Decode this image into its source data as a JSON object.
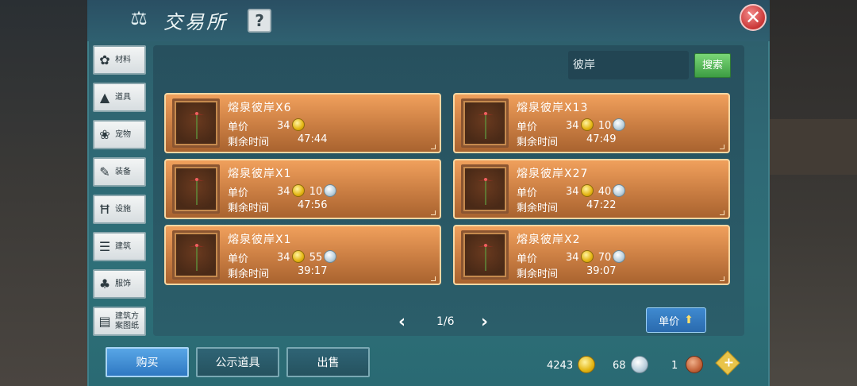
{
  "title": {
    "text": "交易所",
    "help": "?",
    "close": "✕"
  },
  "sidebar": {
    "items": [
      {
        "label": "材料",
        "icon": "materials-icon"
      },
      {
        "label": "道具",
        "icon": "props-icon"
      },
      {
        "label": "宠物",
        "icon": "pet-icon"
      },
      {
        "label": "装备",
        "icon": "equipment-icon"
      },
      {
        "label": "设施",
        "icon": "facility-icon"
      },
      {
        "label": "建筑",
        "icon": "building-icon"
      },
      {
        "label": "服饰",
        "icon": "clothing-icon"
      },
      {
        "label": "建筑方\n案图纸",
        "icon": "blueprint-icon"
      }
    ]
  },
  "search": {
    "value": "彼岸",
    "button": "搜索"
  },
  "labels": {
    "price": "单价",
    "time_left": "剩余时间"
  },
  "items": [
    {
      "name": "熔泉彼岸X6",
      "gold": "34",
      "silver": "",
      "time": "47:44"
    },
    {
      "name": "熔泉彼岸X13",
      "gold": "34",
      "silver": "10",
      "time": "47:49"
    },
    {
      "name": "熔泉彼岸X1",
      "gold": "34",
      "silver": "10",
      "time": "47:56"
    },
    {
      "name": "熔泉彼岸X27",
      "gold": "34",
      "silver": "40",
      "time": "47:22"
    },
    {
      "name": "熔泉彼岸X1",
      "gold": "34",
      "silver": "55",
      "time": "39:17"
    },
    {
      "name": "熔泉彼岸X2",
      "gold": "34",
      "silver": "70",
      "time": "39:07"
    }
  ],
  "pagination": {
    "prev": "‹",
    "page": "1/6",
    "next": "›"
  },
  "sort": {
    "label": "单价",
    "icon": "sort-arrow-icon"
  },
  "bottom": {
    "buy": "购买",
    "showcase": "公示道具",
    "sell": "出售"
  },
  "currency": {
    "gold": "4243",
    "silver": "68",
    "bronze": "1",
    "add": "+"
  },
  "colors": {
    "window": "#2e6a75",
    "card": "#d1874a",
    "buy_button": "#3f8fd6",
    "search_button": "#4fb352"
  }
}
